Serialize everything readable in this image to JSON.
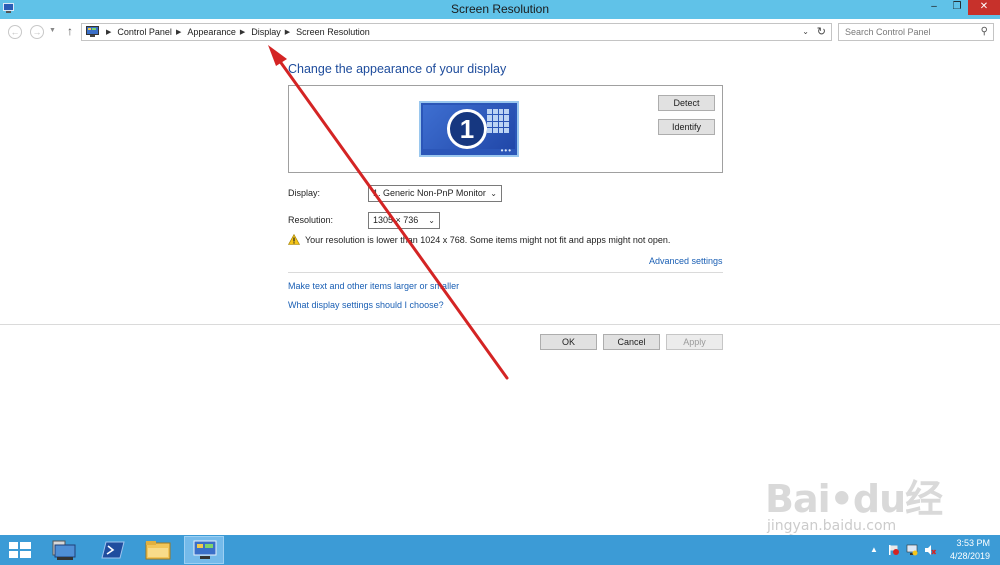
{
  "window": {
    "title": "Screen Resolution",
    "minimize_label": "–",
    "maximize_label": "❐",
    "close_label": "✕"
  },
  "nav": {
    "breadcrumbs": [
      "Control Panel",
      "Appearance",
      "Display",
      "Screen Resolution"
    ],
    "search_placeholder": "Search Control Panel"
  },
  "content": {
    "heading": "Change the appearance of your display",
    "monitor_number": "1",
    "detect_label": "Detect",
    "identify_label": "Identify",
    "display_label": "Display:",
    "display_value": "1. Generic Non-PnP Monitor",
    "resolution_label": "Resolution:",
    "resolution_value": "1305 × 736",
    "warning_text": "Your resolution is lower than 1024 x 768. Some items might not fit and apps might not open.",
    "advanced_link": "Advanced settings",
    "text_size_link": "Make text and other items larger or smaller",
    "choose_link": "What display settings should I choose?"
  },
  "buttons": {
    "ok": "OK",
    "cancel": "Cancel",
    "apply": "Apply"
  },
  "watermark": {
    "main": "Bai•du经验",
    "sub": "jingyan.baidu.com"
  },
  "taskbar": {
    "time": "3:53 PM",
    "date": "4/28/2019"
  },
  "colors": {
    "titlebar": "#60c2e8",
    "taskbar": "#3c9bd6",
    "link": "#1a5fb4",
    "heading": "#1e4c9c",
    "annotation_arrow": "#d42424"
  }
}
